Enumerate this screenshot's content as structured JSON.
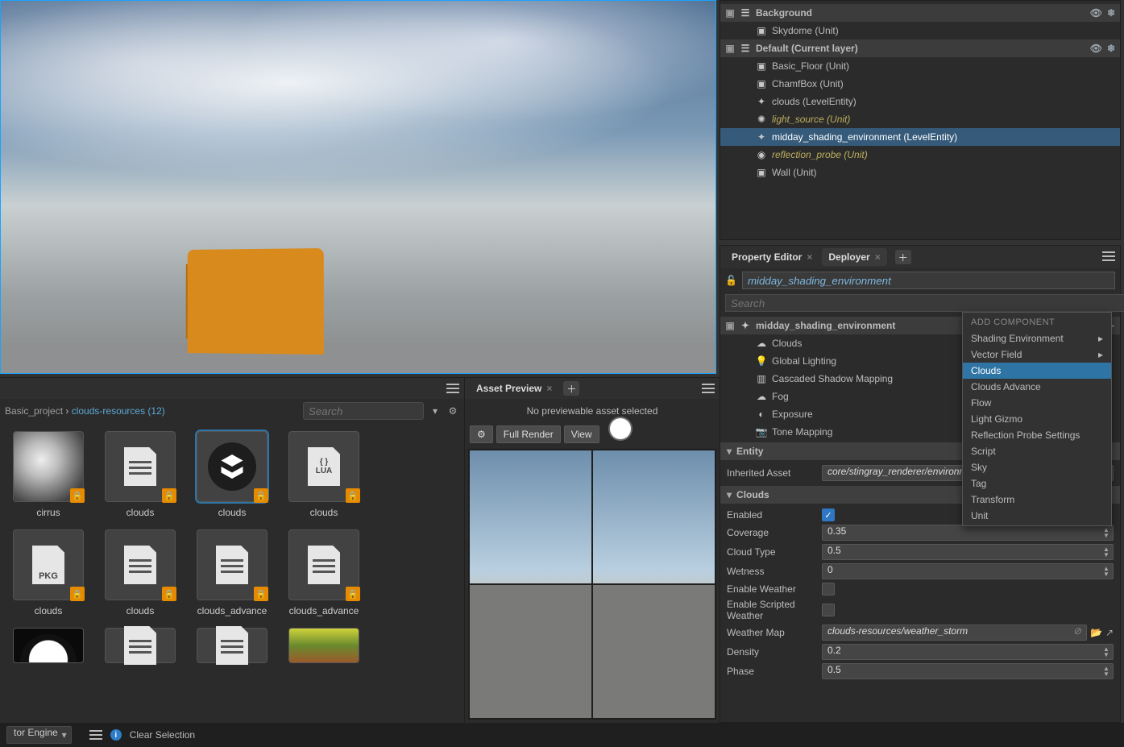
{
  "scene": {
    "groups": [
      {
        "name": "Background",
        "items": [
          {
            "label": "Skydome (Unit)",
            "icon": "cube-icon"
          }
        ]
      },
      {
        "name": "Default (Current layer)",
        "items": [
          {
            "label": "Basic_Floor (Unit)",
            "icon": "cube-icon"
          },
          {
            "label": "ChamfBox (Unit)",
            "icon": "cube-icon"
          },
          {
            "label": "clouds (LevelEntity)",
            "icon": "entity-icon"
          },
          {
            "label": "light_source (Unit)",
            "icon": "light-icon",
            "italic": true
          },
          {
            "label": "midday_shading_environment (LevelEntity)",
            "icon": "entity-icon",
            "selected": true
          },
          {
            "label": "reflection_probe (Unit)",
            "icon": "probe-icon",
            "italic": true
          },
          {
            "label": "Wall (Unit)",
            "icon": "cube-icon"
          }
        ]
      }
    ]
  },
  "property_tabs": {
    "tab1": "Property Editor",
    "tab2": "Deployer"
  },
  "entity_name": "midday_shading_environment",
  "search_placeholder": "Search",
  "component_tree_root": "midday_shading_environment",
  "components": [
    "Clouds",
    "Global Lighting",
    "Cascaded Shadow Mapping",
    "Fog",
    "Exposure",
    "Tone Mapping"
  ],
  "component_icons": [
    "cloud-icon",
    "bulb-icon",
    "bars-icon",
    "cloud-icon",
    "aperture-icon",
    "camera-icon"
  ],
  "add_component_menu": {
    "title": "ADD COMPONENT",
    "items": [
      "Shading Environment",
      "Vector Field",
      "Clouds",
      "Clouds Advance",
      "Flow",
      "Light Gizmo",
      "Reflection Probe Settings",
      "Script",
      "Sky",
      "Tag",
      "Transform",
      "Unit"
    ],
    "submenu_flags": [
      true,
      true,
      false,
      false,
      false,
      false,
      false,
      false,
      false,
      false,
      false,
      false
    ],
    "highlighted": "Clouds"
  },
  "entity_section": {
    "title": "Entity",
    "inherited_label": "Inherited Asset",
    "inherited_value": "core/stingray_renderer/environmen"
  },
  "clouds_section": {
    "title": "Clouds",
    "rows": {
      "Enabled": true,
      "Coverage": "0.35",
      "Cloud Type": "0.5",
      "Wetness": "0",
      "Enable Weather": false,
      "Enable Scripted Weather": false,
      "Weather Map": "clouds-resources/weather_storm",
      "Density": "0.2",
      "Phase": "0.5"
    }
  },
  "asset_browser": {
    "breadcrumb_root": "Basic_project",
    "breadcrumb_current": "clouds-resources (12)",
    "search_placeholder": "Search",
    "items": [
      {
        "label": "cirrus",
        "kind": "tex-cirrus"
      },
      {
        "label": "clouds",
        "kind": "doc"
      },
      {
        "label": "clouds",
        "kind": "puzzle",
        "selected": true
      },
      {
        "label": "clouds",
        "kind": "lua"
      },
      {
        "label": "",
        "kind": "blank"
      },
      {
        "label": "clouds",
        "kind": "pkg"
      },
      {
        "label": "clouds",
        "kind": "doc"
      },
      {
        "label": "clouds_advance",
        "kind": "doc"
      },
      {
        "label": "clouds_advance",
        "kind": "doc"
      },
      {
        "label": "",
        "kind": "blank"
      },
      {
        "label": "",
        "kind": "moon"
      },
      {
        "label": "",
        "kind": "doc-half"
      },
      {
        "label": "",
        "kind": "doc-half"
      },
      {
        "label": "",
        "kind": "tex-grad"
      }
    ]
  },
  "asset_preview": {
    "tab": "Asset Preview",
    "message": "No previewable asset selected",
    "full_render": "Full Render",
    "view": "View"
  },
  "footer": {
    "combo": "tor Engine",
    "clear": "Clear Selection"
  }
}
